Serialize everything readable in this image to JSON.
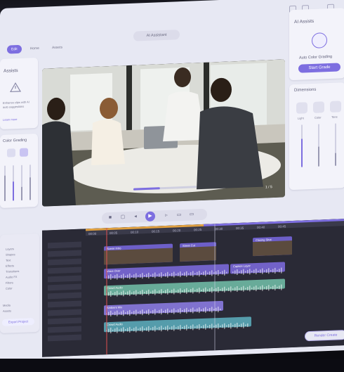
{
  "app": {
    "title": "AI Assistant",
    "nav": [
      "Edit",
      "Home",
      "Assets"
    ],
    "nav_active": "Edit"
  },
  "left_panel": {
    "title": "Assists",
    "desc_line1": "Enhance clips with AI",
    "desc_line2": "auto suggestions",
    "btn": "Learn more"
  },
  "levels_panel": {
    "title": "Color Grading",
    "sliders": [
      0.72,
      0.55,
      0.38,
      0.64
    ]
  },
  "right_panel": {
    "title": "AI Assists",
    "feature": "Auto Color Grading",
    "btn": "Start Grade"
  },
  "sub_panel": {
    "title": "Dimensions",
    "labels": [
      "Light",
      "Color",
      "Tone"
    ]
  },
  "video": {
    "time": "1 / 5",
    "progress": 0.42
  },
  "player": {
    "icons": [
      "prev-icon",
      "frame-icon",
      "play-icon",
      "next-icon",
      "loop-icon"
    ]
  },
  "timeline": {
    "ruler": [
      "00:00",
      "00:05",
      "00:10",
      "00:15",
      "00:20",
      "00:25",
      "00:30",
      "00:35",
      "00:40",
      "00:45"
    ],
    "clips": [
      "Scene Intro",
      "Street Cut",
      "Office Cut",
      "Closing Shot",
      "Crowd Audio",
      "Voice Over",
      "Caption Layer",
      "Ambient Mix"
    ],
    "left_items": [
      "Layers",
      "Shapes",
      "Text",
      "Effects",
      "Transitions",
      "Audio FX",
      "Filters",
      "Color"
    ],
    "left_bottom": [
      "Media",
      "Assets"
    ],
    "export_btn": "Export Project",
    "render_btn": "Render Create"
  },
  "colors": {
    "accent": "#7d6ee0",
    "panel": "#f3f3fa",
    "timeline_bg": "#2a2a36",
    "playhead": "#e05050"
  }
}
